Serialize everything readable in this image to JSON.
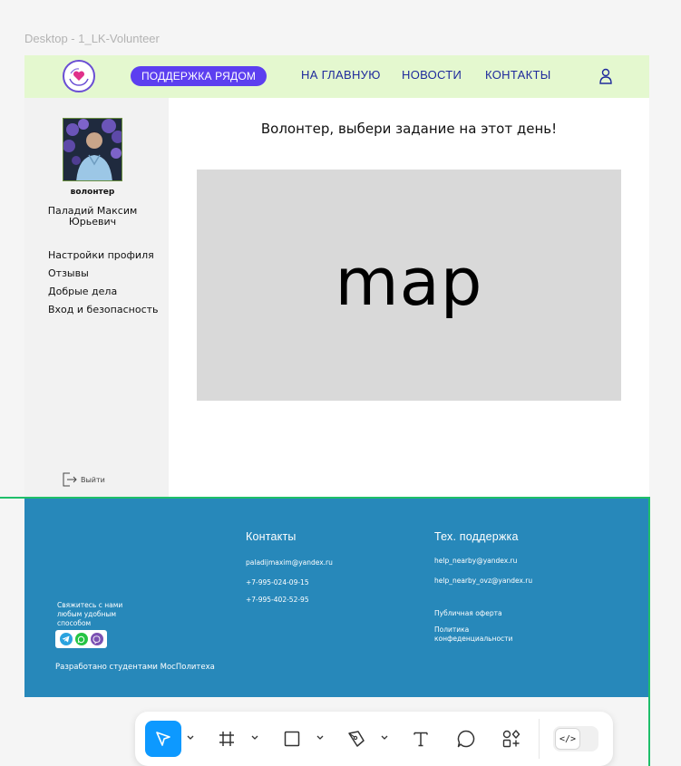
{
  "frame_label": "Desktop - 1_LK-Volunteer",
  "header": {
    "brand": "ПОДДЕРЖКА РЯДОМ",
    "nav": [
      "НА ГЛАВНУЮ",
      "НОВОСТИ",
      "КОНТАКТЫ"
    ],
    "user_icon": "user-icon"
  },
  "sidebar": {
    "role": "волонтер",
    "name": "Паладий Максим Юрьевич",
    "menu": [
      "Настройки профиля",
      "Отзывы",
      "Добрые дела",
      "Вход и безопасность"
    ],
    "logout": "Выйти"
  },
  "main": {
    "title": "Волонтер, выбери задание на этот день!",
    "map_placeholder": "map"
  },
  "footer": {
    "contact_prompt": "Свяжитесь с нами любым удобным способом",
    "developed_by": "Разработано студентами МосПолитеха",
    "contacts": {
      "title": "Контакты",
      "email": "paladijmaxim@yandex.ru",
      "phone1": "+7-995-024-09-15",
      "phone2": "+7-995-402-52-95"
    },
    "support": {
      "title": "Тех. поддержка",
      "email1": "help_nearby@yandex.ru",
      "email2": "help_nearby_ovz@yandex.ru",
      "offer": "Публичная оферта",
      "privacy": "Политика конфеденциальности"
    },
    "messengers": [
      "telegram-icon",
      "whatsapp-icon",
      "viber-icon"
    ]
  },
  "toolbar": {
    "tools": [
      "move-tool",
      "frame-tool",
      "rectangle-tool",
      "pen-tool",
      "text-tool",
      "comment-tool",
      "actions-tool",
      "dev-mode-toggle"
    ],
    "dev_mode_label": "</>"
  },
  "colors": {
    "header_bg": "#e4f8cf",
    "brand_pill": "#5c3ff0",
    "nav_text": "#1e2a9c",
    "footer_bg": "#2788ba",
    "map_bg": "#d9d9d9",
    "selection_green": "#1fbf6a",
    "tool_active": "#0d99ff"
  }
}
